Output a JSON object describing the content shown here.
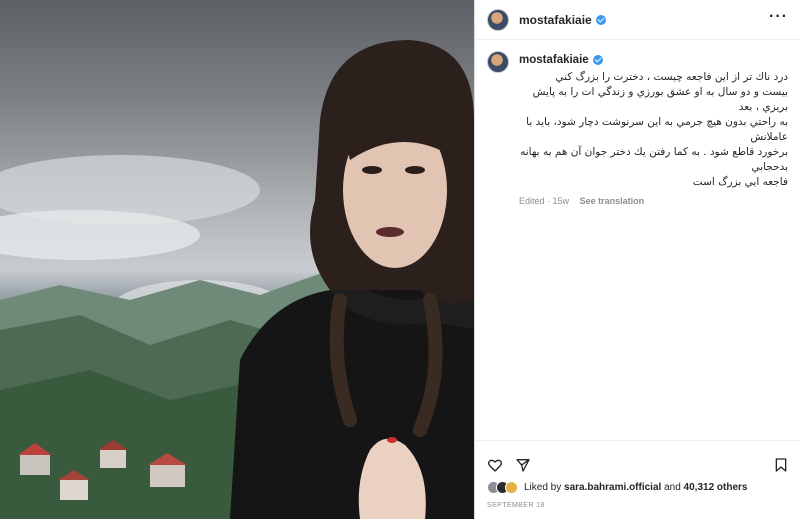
{
  "post": {
    "username": "mostafakiaie",
    "caption_lines": [
      "درد ناك تر از اين فاجعه چيست ، دخترت را بزرگ كني",
      "بيست و دو سال به او عشق بورزي و زندگي ات را به پايش بريزي ، بعد",
      "به راحتي بدون هيچ جرمي به اين سرنوشت دچار شود، بايد با عاملانش",
      "برخورد قاطع شود . به كما رفتن يك دختر جوان آن هم به بهانه بدحجابي",
      "فاجعه ايي بزرگ است"
    ],
    "edited_label": "Edited",
    "age": "15w",
    "see_translation": "See translation",
    "liked_by_prefix": "Liked by",
    "liked_by_user": "sara.bahrami.official",
    "liked_by_and": "and",
    "likes_count": "40,312 others",
    "date": "SEPTEMBER 18"
  },
  "icons": {
    "more": "more-options-icon",
    "like": "heart-icon",
    "share": "share-icon",
    "save": "bookmark-icon",
    "verified": "verified-badge-icon"
  },
  "colors": {
    "verified": "#3897f0",
    "text": "#262626",
    "muted": "#8e8e8e"
  }
}
